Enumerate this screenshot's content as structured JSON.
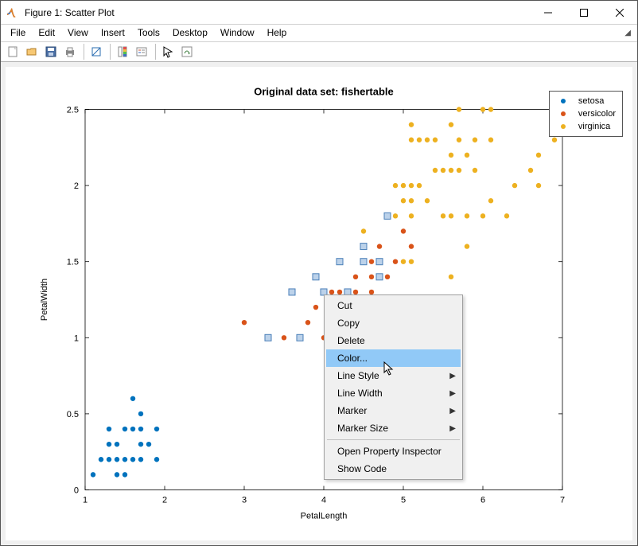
{
  "window": {
    "title": "Figure 1: Scatter Plot"
  },
  "menus": {
    "file": "File",
    "edit": "Edit",
    "view": "View",
    "insert": "Insert",
    "tools": "Tools",
    "desktop": "Desktop",
    "window": "Window",
    "help": "Help"
  },
  "toolbar_icons": [
    "new",
    "open",
    "save",
    "print",
    "sep",
    "link",
    "layout-single",
    "layout-multi",
    "sep",
    "pointer",
    "rotate"
  ],
  "context_menu": {
    "cut": "Cut",
    "copy": "Copy",
    "delete": "Delete",
    "color": "Color...",
    "linestyle": "Line Style",
    "linewidth": "Line Width",
    "marker": "Marker",
    "markersize": "Marker Size",
    "openprop": "Open Property Inspector",
    "showcode": "Show Code"
  },
  "legend": {
    "setosa": "setosa",
    "versicolor": "versicolor",
    "virginica": "virginica"
  },
  "chart_data": {
    "type": "scatter",
    "title": "Original data set: fishertable",
    "xlabel": "PetalLength",
    "ylabel": "PetalWidth",
    "xlim": [
      1,
      7
    ],
    "ylim": [
      0,
      2.5
    ],
    "xticks": [
      1,
      2,
      3,
      4,
      5,
      6,
      7
    ],
    "yticks": [
      0,
      0.5,
      1,
      1.5,
      2,
      2.5
    ],
    "colors": {
      "setosa": "#0072bd",
      "versicolor": "#d95319",
      "virginica": "#edb120",
      "brushed": "#4a7fb8"
    },
    "series": [
      {
        "name": "setosa",
        "marker": "circle",
        "points": [
          [
            1.1,
            0.1
          ],
          [
            1.2,
            0.2
          ],
          [
            1.3,
            0.2
          ],
          [
            1.3,
            0.3
          ],
          [
            1.3,
            0.4
          ],
          [
            1.4,
            0.1
          ],
          [
            1.4,
            0.2
          ],
          [
            1.4,
            0.3
          ],
          [
            1.5,
            0.1
          ],
          [
            1.5,
            0.2
          ],
          [
            1.5,
            0.4
          ],
          [
            1.6,
            0.2
          ],
          [
            1.6,
            0.4
          ],
          [
            1.6,
            0.6
          ],
          [
            1.7,
            0.2
          ],
          [
            1.7,
            0.3
          ],
          [
            1.7,
            0.4
          ],
          [
            1.7,
            0.5
          ],
          [
            1.8,
            0.3
          ],
          [
            1.9,
            0.2
          ],
          [
            1.9,
            0.4
          ]
        ]
      },
      {
        "name": "versicolor",
        "marker": "circle",
        "points": [
          [
            3.0,
            1.1
          ],
          [
            3.5,
            1.0
          ],
          [
            3.8,
            1.1
          ],
          [
            3.9,
            1.2
          ],
          [
            4.0,
            1.0
          ],
          [
            4.0,
            1.3
          ],
          [
            4.1,
            1.0
          ],
          [
            4.1,
            1.3
          ],
          [
            4.2,
            1.2
          ],
          [
            4.2,
            1.3
          ],
          [
            4.3,
            1.3
          ],
          [
            4.4,
            1.2
          ],
          [
            4.4,
            1.3
          ],
          [
            4.4,
            1.4
          ],
          [
            4.5,
            1.5
          ],
          [
            4.6,
            1.3
          ],
          [
            4.6,
            1.4
          ],
          [
            4.6,
            1.5
          ],
          [
            4.7,
            1.2
          ],
          [
            4.7,
            1.4
          ],
          [
            4.7,
            1.5
          ],
          [
            4.7,
            1.6
          ],
          [
            4.8,
            1.4
          ],
          [
            4.8,
            1.8
          ],
          [
            4.9,
            1.5
          ],
          [
            5.0,
            1.7
          ],
          [
            5.1,
            1.6
          ]
        ]
      },
      {
        "name": "virginica",
        "marker": "circle",
        "points": [
          [
            4.5,
            1.7
          ],
          [
            4.8,
            1.8
          ],
          [
            4.9,
            1.8
          ],
          [
            4.9,
            2.0
          ],
          [
            5.0,
            1.5
          ],
          [
            5.0,
            1.9
          ],
          [
            5.0,
            2.0
          ],
          [
            5.1,
            1.5
          ],
          [
            5.1,
            1.8
          ],
          [
            5.1,
            1.9
          ],
          [
            5.1,
            2.0
          ],
          [
            5.1,
            2.3
          ],
          [
            5.1,
            2.4
          ],
          [
            5.2,
            2.0
          ],
          [
            5.2,
            2.3
          ],
          [
            5.3,
            1.9
          ],
          [
            5.3,
            2.3
          ],
          [
            5.4,
            2.1
          ],
          [
            5.4,
            2.3
          ],
          [
            5.5,
            1.8
          ],
          [
            5.5,
            2.1
          ],
          [
            5.6,
            1.4
          ],
          [
            5.6,
            1.8
          ],
          [
            5.6,
            2.1
          ],
          [
            5.6,
            2.2
          ],
          [
            5.6,
            2.4
          ],
          [
            5.7,
            2.1
          ],
          [
            5.7,
            2.3
          ],
          [
            5.7,
            2.5
          ],
          [
            5.8,
            1.6
          ],
          [
            5.8,
            1.8
          ],
          [
            5.8,
            2.2
          ],
          [
            5.9,
            2.1
          ],
          [
            5.9,
            2.3
          ],
          [
            6.0,
            1.8
          ],
          [
            6.0,
            2.5
          ],
          [
            6.1,
            1.9
          ],
          [
            6.1,
            2.3
          ],
          [
            6.1,
            2.5
          ],
          [
            6.3,
            1.8
          ],
          [
            6.4,
            2.0
          ],
          [
            6.6,
            2.1
          ],
          [
            6.7,
            2.0
          ],
          [
            6.7,
            2.2
          ],
          [
            6.9,
            2.3
          ]
        ]
      },
      {
        "name": "brushed",
        "marker": "square",
        "points": [
          [
            3.3,
            1.0
          ],
          [
            3.9,
            1.4
          ],
          [
            4.0,
            1.3
          ],
          [
            4.2,
            1.5
          ],
          [
            4.3,
            1.3
          ],
          [
            4.5,
            1.5
          ],
          [
            4.5,
            1.6
          ],
          [
            4.7,
            1.4
          ],
          [
            4.7,
            1.5
          ],
          [
            4.8,
            1.8
          ],
          [
            3.6,
            1.3
          ],
          [
            3.7,
            1.0
          ]
        ]
      }
    ]
  }
}
